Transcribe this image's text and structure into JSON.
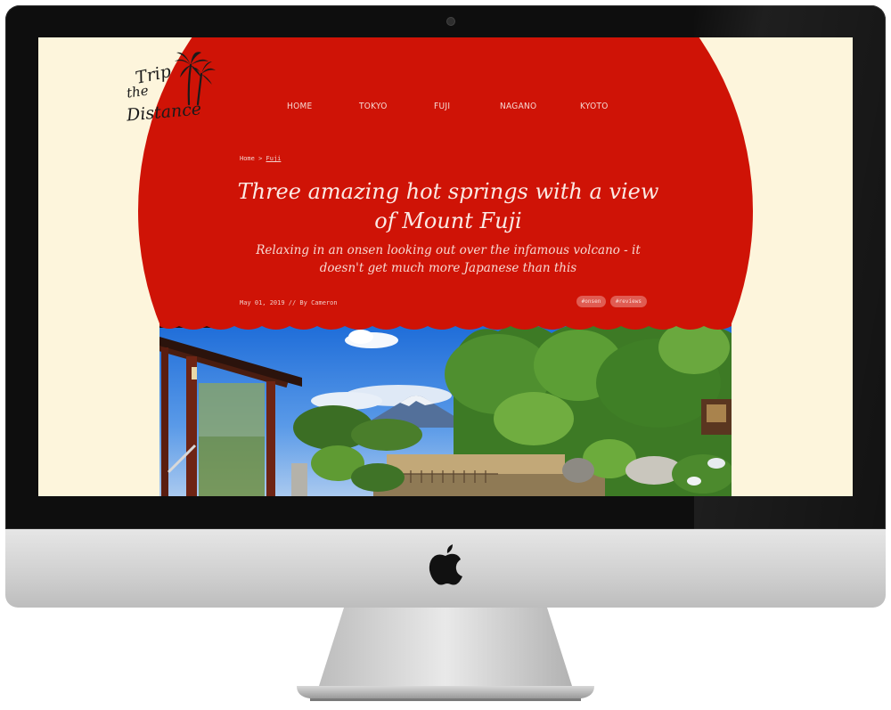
{
  "site": {
    "logo": {
      "line1": "Trip",
      "line2": "the",
      "line3": "Distance"
    },
    "nav": [
      {
        "label": "HOME"
      },
      {
        "label": "TOKYO"
      },
      {
        "label": "FUJI"
      },
      {
        "label": "NAGANO"
      },
      {
        "label": "KYOTO"
      }
    ]
  },
  "article": {
    "breadcrumb": {
      "home": "Home",
      "separator": ">",
      "current": "Fuji"
    },
    "title": "Three amazing hot springs with a view of Mount Fuji",
    "subtitle": "Relaxing in an onsen looking out over the infamous volcano - it doesn't get much more Japanese than this",
    "meta": "May 01, 2019 // By Cameron",
    "tags": [
      "#onsen",
      "#reviews"
    ]
  },
  "colors": {
    "background": "#fdf5dc",
    "sun_red": "#cf1306",
    "tag_bg": "#e05c52",
    "bezel": "#0e0e0e"
  },
  "icons": {
    "device_logo": "apple-icon",
    "logo_graphic": "palm-tree-icon"
  }
}
